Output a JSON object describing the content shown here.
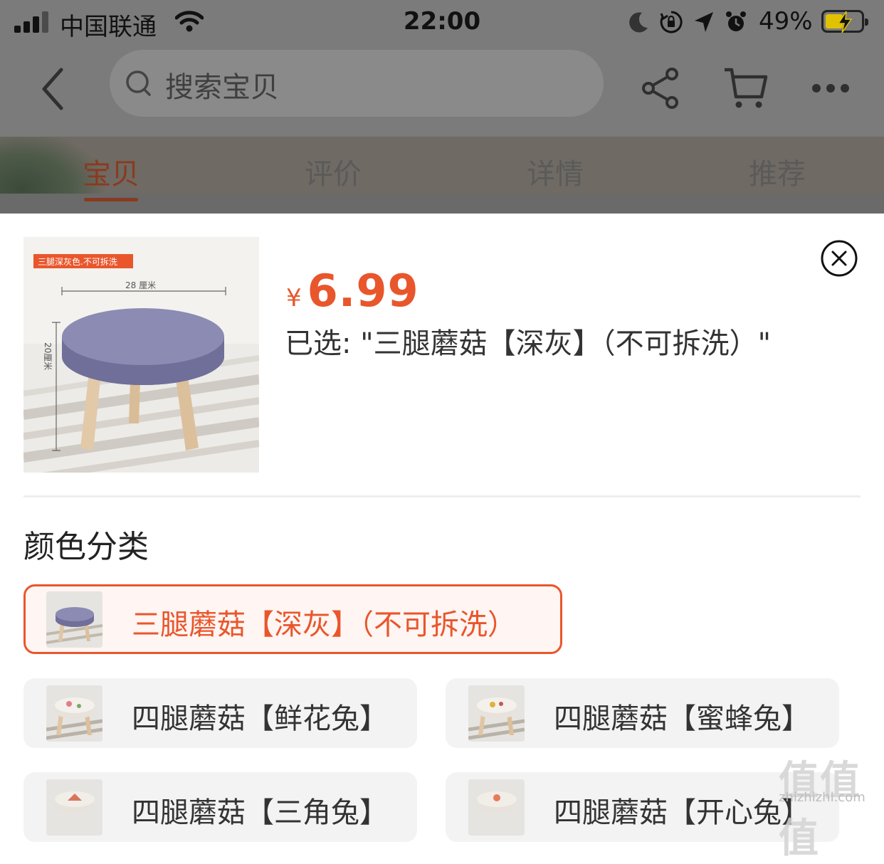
{
  "status_bar": {
    "carrier": "中国联通",
    "time": "22:00",
    "battery": "49%",
    "battery_level": 0.49
  },
  "header": {
    "search_placeholder": "搜索宝贝",
    "icons": [
      "back-icon",
      "search-icon",
      "share-icon",
      "cart-icon",
      "more-icon"
    ]
  },
  "tabs": [
    {
      "label": "宝贝",
      "active": true
    },
    {
      "label": "评价",
      "active": false
    },
    {
      "label": "详情",
      "active": false
    },
    {
      "label": "推荐",
      "active": false
    }
  ],
  "product": {
    "image_caption": "三腿深灰色.不可拆洗",
    "width_label": "28 厘米",
    "height_label": "20厘米",
    "currency": "¥",
    "price": "6.99",
    "selected_text": "已选: \"三腿蘑菇【深灰】（不可拆洗）\""
  },
  "variants": {
    "title": "颜色分类",
    "options": [
      {
        "label": "三腿蘑菇【深灰】（不可拆洗）",
        "selected": true
      },
      {
        "label": "四腿蘑菇【鲜花兔】",
        "selected": false
      },
      {
        "label": "四腿蘑菇【蜜蜂兔】",
        "selected": false
      },
      {
        "label": "四腿蘑菇【三角兔】",
        "selected": false
      },
      {
        "label": "四腿蘑菇【开心兔】",
        "selected": false
      }
    ]
  },
  "watermark": {
    "main": "值值值",
    "sub": "zhizhizhi.com"
  },
  "colors": {
    "accent": "#e9562c",
    "overlay": "#7b7b7b",
    "option_bg": "#f3f3f3"
  }
}
